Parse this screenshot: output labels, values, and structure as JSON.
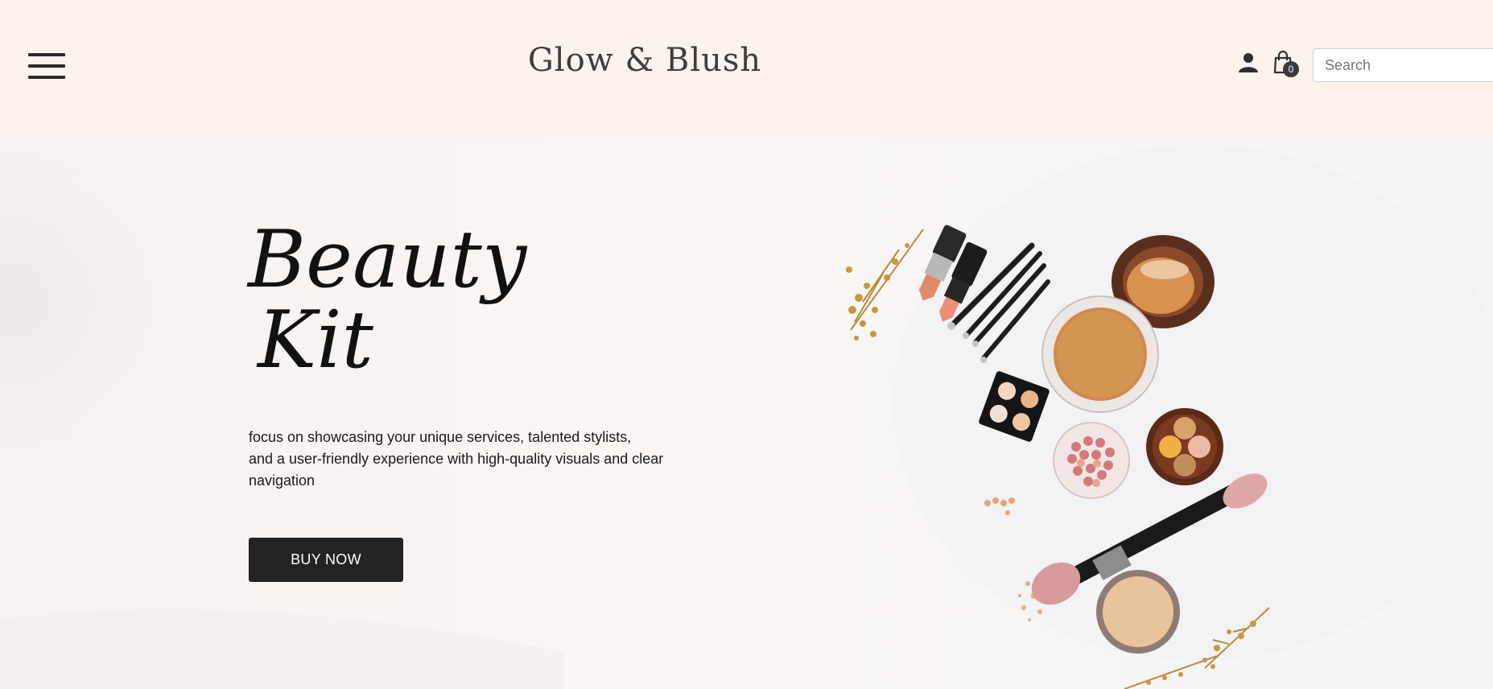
{
  "header": {
    "brand": "Glow & Blush",
    "search_placeholder": "Search",
    "cart_count": "0"
  },
  "hero": {
    "title_line1": "Beauty",
    "title_line2": "Kit",
    "description_line1": "focus on showcasing your unique services, talented stylists,",
    "description_line2": "and a user-friendly experience with high-quality visuals and clear navigation",
    "button_label": "BUY NOW"
  },
  "colors": {
    "header_bg": "#fdf3ec",
    "button_bg": "#232323",
    "text_dark": "#111111"
  },
  "icons": {
    "menu": "hamburger-menu-icon",
    "user": "user-icon",
    "cart": "shopping-bag-icon"
  }
}
